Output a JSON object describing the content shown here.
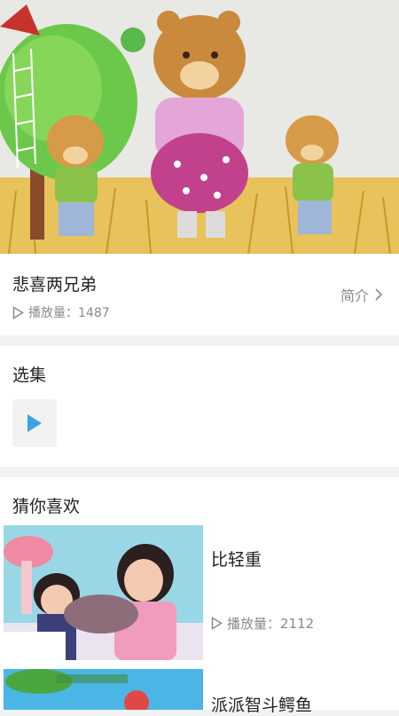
{
  "video": {
    "title": "悲喜两兄弟",
    "plays_label": "播放量：1487",
    "intro_label": "简介"
  },
  "episodes": {
    "section_title": "选集"
  },
  "recommendations": {
    "section_title": "猜你喜欢",
    "items": [
      {
        "title": "比轻重",
        "plays_label": "播放量：2112"
      },
      {
        "title": "派派智斗鳄鱼"
      }
    ]
  },
  "colors": {
    "accent_play": "#3aa3e3",
    "text_primary": "#222222",
    "text_secondary": "#8a8a8a"
  }
}
